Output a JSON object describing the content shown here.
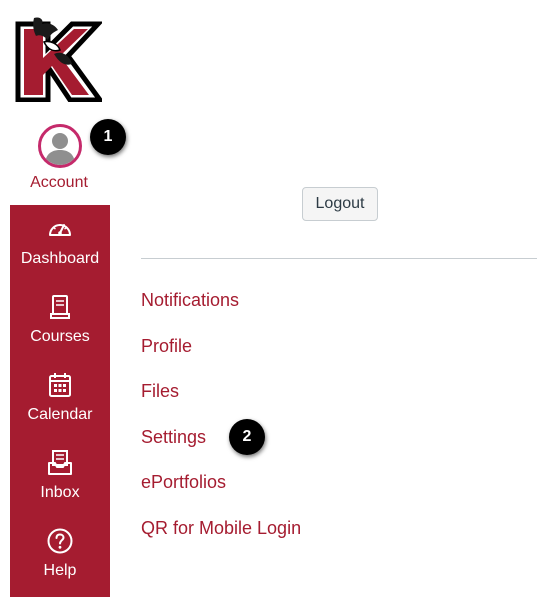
{
  "brand": {
    "accent": "#a51c30",
    "avatar_ring": "#c52a6b",
    "logo_letter": "K"
  },
  "account": {
    "label": "Account"
  },
  "nav": [
    {
      "label": "Dashboard",
      "icon": "speedometer-icon"
    },
    {
      "label": "Courses",
      "icon": "book-icon"
    },
    {
      "label": "Calendar",
      "icon": "calendar-icon"
    },
    {
      "label": "Inbox",
      "icon": "inbox-icon"
    },
    {
      "label": "Help",
      "icon": "question-circle-icon"
    }
  ],
  "tray": {
    "logout_label": "Logout",
    "links": [
      "Notifications",
      "Profile",
      "Files",
      "Settings",
      "ePortfolios",
      "QR for Mobile Login"
    ]
  },
  "callouts": [
    "1",
    "2"
  ]
}
